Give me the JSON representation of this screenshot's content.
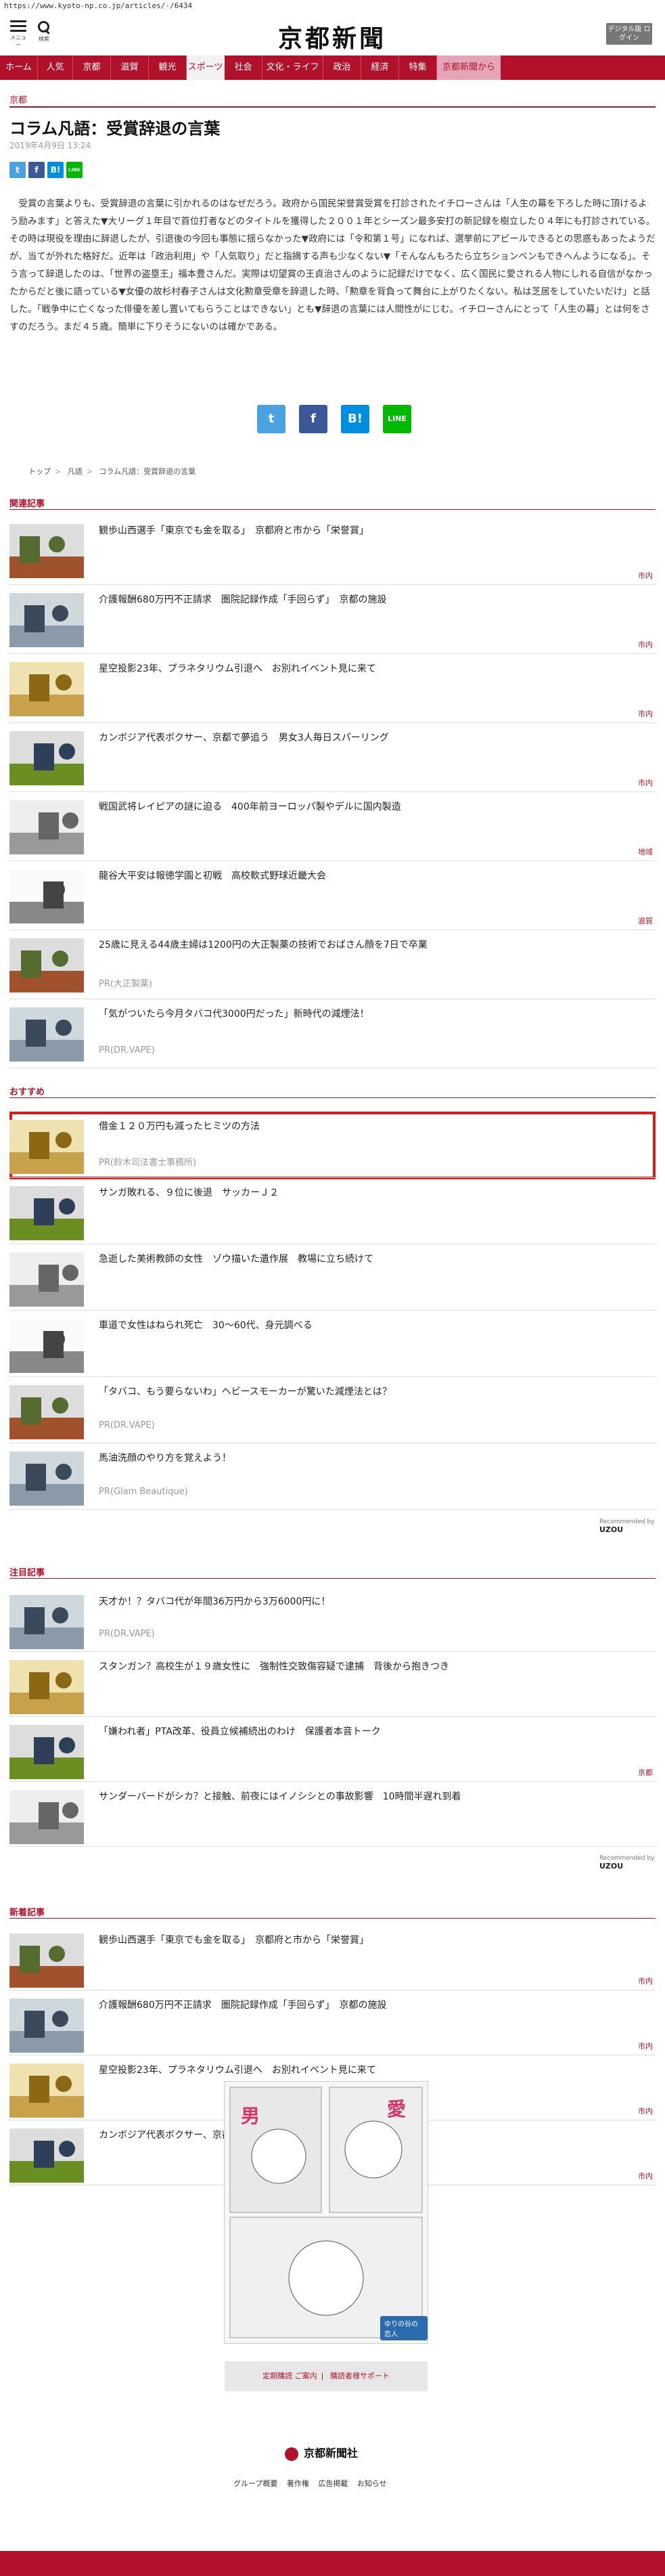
{
  "browser": {
    "url": "https://www.kyoto-np.co.jp/articles/-/6434"
  },
  "header": {
    "menu_label": "メニュー",
    "search_label": "検索",
    "logo": "京都新聞",
    "digital_label": "デジタル版 ログイン"
  },
  "nav": {
    "items": [
      "ホーム",
      "人気",
      "京都",
      "滋賀",
      "観光",
      "スポーツ",
      "社会",
      "文化・ライフ",
      "政治",
      "経済",
      "特集",
      "京都新聞から"
    ],
    "active": "スポーツ"
  },
  "article": {
    "section": "京都",
    "title": "コラム凡語：受賞辞退の言葉",
    "date": "2019年4月9日 13:24",
    "body": "受賞の言葉よりも、受賞辞退の言葉に引かれるのはなぜだろう。政府から国民栄誉賞受賞を打診されたイチローさんは「人生の幕を下ろした時に頂けるよう励みます」と答えた▼大リーグ１年目で首位打者などのタイトルを獲得した２００１年とシーズン最多安打の新記録を樹立した０４年にも打診されている。その時は現役を理由に辞退したが、引退後の今回も事態に揺らなかった▼政府には「令和第１号」になれば、選挙前にアピールできるとの思惑もあったようだが、当てが外れた格好だ。近年は「政治利用」や「人気取り」だと指摘する声も少なくない▼「そんなんもろたら立ちションベンもできへんようになる」。そう言って辞退したのは、「世界の盗塁王」福本豊さんだ。実際は切望賞の王貞治さんのように記録だけでなく、広く国民に愛される人物にしれる自信がなかったからだと後に語っている▼女優の故杉村春子さんは文化勲章受章を辞退した時、「勲章を背負って舞台に上がりたくない。私は芝居をしていたいだけ」と話した。「戦争中に亡くなった俳優を差し置いてもらうことはできない」とも▼辞退の言葉には人間性がにじむ。イチローさんにとって「人生の幕」とは何をさすのだろう。まだ４５歳。簡単に下りそうにないのは確かである。"
  },
  "share": {
    "twitter": "t",
    "facebook": "f",
    "hatena": "B!",
    "line": "LINE"
  },
  "breadcrumb": [
    "トップ",
    "凡語",
    "コラム凡語：受賞辞退の言葉"
  ],
  "related": {
    "heading": "関連記事",
    "items": [
      {
        "title": "観歩山西選手「東京でも金を取る」　京都府と市から「栄誉賞」",
        "tag": "市内",
        "pr": ""
      },
      {
        "title": "介護報酬680万円不正請求　圏院記録作成「手回らず」　京都の施設",
        "tag": "市内",
        "pr": ""
      },
      {
        "title": "星空投影23年、プラネタリウム引退へ　お別れイベント見に来て",
        "tag": "市内",
        "pr": ""
      },
      {
        "title": "カンボジア代表ボクサー、京都で夢追う　男女3人毎日スパーリング",
        "tag": "市内",
        "pr": ""
      },
      {
        "title": "戦国武将レイピアの謎に迫る　400年前ヨーロッパ製やデルに国内製造",
        "tag": "地域",
        "pr": ""
      },
      {
        "title": "龍谷大平安は報徳学園と初戦　高校軟式野球近畿大会",
        "tag": "滋賀",
        "pr": ""
      },
      {
        "title": "25歳に見える44歳主婦は1200円の大正製薬の技術でおばさん顔を7日で卒業",
        "tag": "",
        "pr": "PR(大正製薬)"
      },
      {
        "title": "「気がついたら今月タバコ代3000円だった」新時代の減煙法！",
        "tag": "",
        "pr": "PR(DR.VAPE)"
      }
    ]
  },
  "recommend": {
    "heading": "おすすめ",
    "items": [
      {
        "title": "借金１２０万円も減ったヒミツの方法",
        "pr": "PR(鈴木司法書士事務所)"
      },
      {
        "title": "サンガ敗れる、９位に後退　サッカーＪ２",
        "pr": ""
      },
      {
        "title": "急逝した美術教師の女性　ゾウ描いた遺作展　教場に立ち続けて",
        "pr": ""
      },
      {
        "title": "車道で女性はねられ死亡　30～60代、身元調べる",
        "pr": ""
      },
      {
        "title": "「タバコ、もう要らないわ」ヘビースモーカーが驚いた減煙法とは？",
        "pr": "PR(DR.VAPE)"
      },
      {
        "title": "馬油洗顔のやり方を覚えよう！",
        "pr": "PR(Glam Beautique)"
      }
    ],
    "recommended_by": "Recommended by",
    "brand": "UZOU"
  },
  "featured": {
    "heading": "注目記事",
    "items": [
      {
        "title": "天才か！？タバコ代が年間36万円から3万6000円に！",
        "tag": "",
        "pr": "PR(DR.VAPE)"
      },
      {
        "title": "スタンガン？高校生が１９歳女性に　強制性交致傷容疑で逮捕　背後から抱きつき",
        "tag": "",
        "pr": ""
      },
      {
        "title": "「嫌われ者」PTA改革、役員立候補続出のわけ　保護者本音トーク",
        "tag": "京都",
        "pr": ""
      },
      {
        "title": "サンダーバードがシカ？と接触、前夜にはイノシシとの事故影響　10時間半遅れ到着",
        "tag": "",
        "pr": ""
      }
    ]
  },
  "newest": {
    "heading": "新着記事",
    "items": [
      {
        "title": "観歩山西選手「東京でも金を取る」　京都府と市から「栄誉賞」",
        "tag": "市内"
      },
      {
        "title": "介護報酬680万円不正請求　圏院記録作成「手回らず」　京都の施設",
        "tag": "市内"
      },
      {
        "title": "星空投影23年、プラネタリウム引退へ　お別れイベント見に来て",
        "tag": "市内"
      },
      {
        "title": "カンボジア代表ボクサー、京都で夢追う　男女3人毎日スパーリング",
        "tag": "市内"
      }
    ]
  },
  "ad": {
    "text": "ゆりの谷の恋人"
  },
  "footer_buttons": {
    "subscribe": "定期購読 ご案内",
    "support": "購読者様サポート"
  },
  "footer": {
    "logo": "京都新聞社",
    "links": [
      "グループ概要",
      "著作権",
      "広告掲載",
      "お知らせ"
    ]
  }
}
